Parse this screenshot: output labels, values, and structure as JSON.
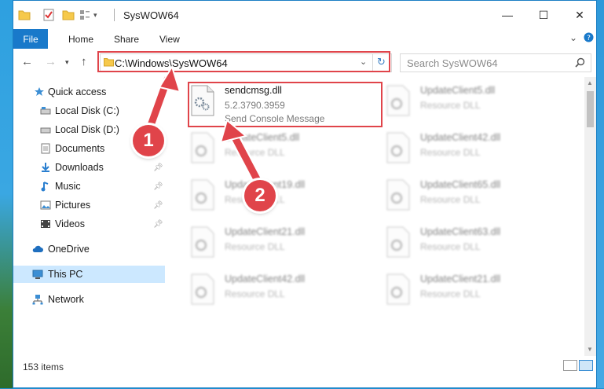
{
  "window": {
    "title": "SysWOW64"
  },
  "quick_access_toolbar": {
    "items": [
      "folder-icon",
      "properties-icon",
      "new-folder-icon",
      "view-icon",
      "dropdown-icon"
    ]
  },
  "window_controls": {
    "minimize": "—",
    "maximize": "☐",
    "close": "✕"
  },
  "ribbon": {
    "tabs": [
      "File",
      "Home",
      "Share",
      "View"
    ],
    "collapse_icon": "chevron-down-icon",
    "help_icon": "help-icon"
  },
  "address_bar": {
    "path": "C:\\Windows\\SysWOW64",
    "refresh_icon": "refresh-icon"
  },
  "search": {
    "placeholder": "Search SysWOW64"
  },
  "nav_pane": {
    "items": [
      {
        "label": "Quick access",
        "icon": "star-icon",
        "pinned": false
      },
      {
        "label": "Local Disk (C:)",
        "icon": "drive-icon",
        "pinned": false
      },
      {
        "label": "Local Disk (D:)",
        "icon": "drive-icon",
        "pinned": false
      },
      {
        "label": "Documents",
        "icon": "documents-icon",
        "pinned": false
      },
      {
        "label": "Downloads",
        "icon": "download-icon",
        "pinned": true
      },
      {
        "label": "Music",
        "icon": "music-icon",
        "pinned": true
      },
      {
        "label": "Pictures",
        "icon": "pictures-icon",
        "pinned": true
      },
      {
        "label": "Videos",
        "icon": "videos-icon",
        "pinned": true
      },
      {
        "label": "OneDrive",
        "icon": "cloud-icon",
        "pinned": false
      },
      {
        "label": "This PC",
        "icon": "computer-icon",
        "pinned": false,
        "selected": true
      },
      {
        "label": "Network",
        "icon": "network-icon",
        "pinned": false
      }
    ]
  },
  "files": {
    "highlighted": {
      "name": "sendcmsg.dll",
      "version": "5.2.3790.3959",
      "description": "Send Console Message"
    },
    "col1": [
      {
        "name": "UpdateClient5.dll",
        "type": "Resource DLL"
      },
      {
        "name": "UpdateClient19.dll",
        "type": "Resource DLL"
      },
      {
        "name": "UpdateClient21.dll",
        "type": "Resource DLL"
      },
      {
        "name": "UpdateClient42.dll",
        "type": "Resource DLL"
      }
    ],
    "col2": [
      {
        "name": "UpdateClient5.dll",
        "type": "Resource DLL"
      },
      {
        "name": "UpdateClient42.dll",
        "type": "Resource DLL"
      },
      {
        "name": "UpdateClient65.dll",
        "type": "Resource DLL"
      },
      {
        "name": "UpdateClient63.dll",
        "type": "Resource DLL"
      },
      {
        "name": "UpdateClient21.dll",
        "type": "Resource DLL"
      }
    ]
  },
  "status": {
    "item_count": "153 items"
  },
  "annotations": {
    "step1": "1",
    "step2": "2"
  },
  "colors": {
    "accent": "#1979ca",
    "highlight": "#e0444a",
    "selection": "#cce8ff"
  }
}
